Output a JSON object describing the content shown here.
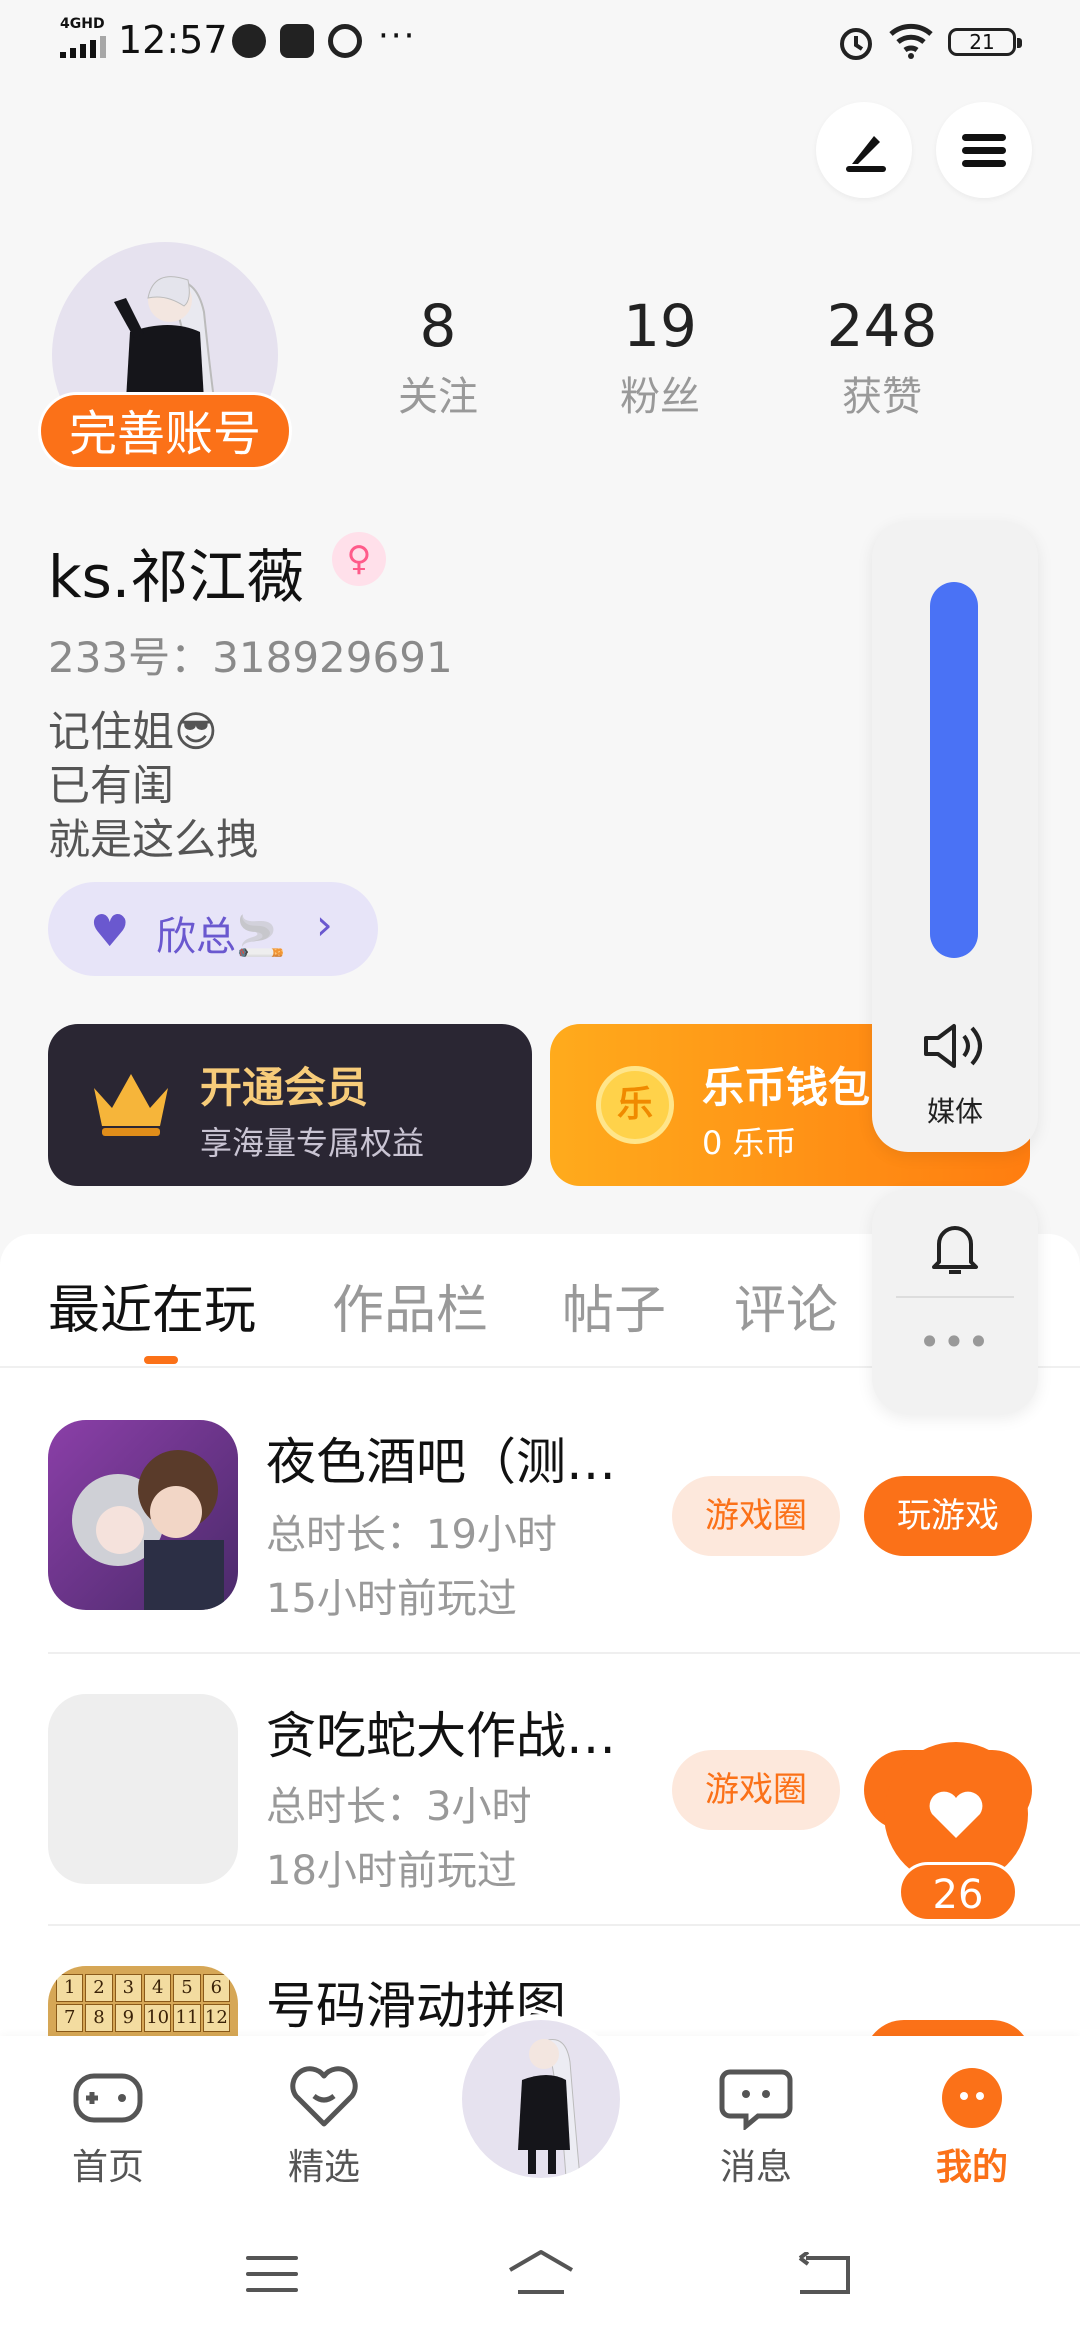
{
  "status_bar": {
    "time": "12:57",
    "network": "4GHD",
    "dots": "···",
    "battery": "21"
  },
  "profile": {
    "complete_label": "完善账号",
    "stats": [
      {
        "num": "8",
        "label": "关注"
      },
      {
        "num": "19",
        "label": "粉丝"
      },
      {
        "num": "248",
        "label": "获赞"
      }
    ],
    "username": "ks.祁江薇",
    "gender_icon": "♀",
    "uid": "233号：318929691",
    "bio": [
      "记住姐😎",
      "已有闺",
      "就是这么拽"
    ],
    "fanclub_label": "欣总🚬",
    "fanclub_arrow": "›"
  },
  "cards": {
    "vip_title": "开通会员",
    "vip_sub": "享海量专属权益",
    "coin_title": "乐币钱包",
    "coin_sub": "0 乐币",
    "coin_symbol": "乐"
  },
  "tabs": [
    {
      "label": "最近在玩",
      "active": true
    },
    {
      "label": "作品栏",
      "active": false
    },
    {
      "label": "帖子",
      "active": false
    },
    {
      "label": "评论",
      "active": false
    }
  ],
  "games": [
    {
      "title": "夜色酒吧（测…",
      "total": "总时长：19小时",
      "last": "15小时前玩过",
      "circle": "游戏圈",
      "play": "玩游戏"
    },
    {
      "title": "贪吃蛇大作战…",
      "total": "总时长：3小时",
      "last": "18小时前玩过",
      "circle": "游戏圈",
      "play": "玩游戏"
    },
    {
      "title": "号码滑动拼图",
      "puzzle": [
        "1",
        "2",
        "3",
        "4",
        "5",
        "6",
        "7",
        "8",
        "9",
        "10",
        "11",
        "12"
      ]
    }
  ],
  "volume": {
    "label": "媒体",
    "level": 1.0,
    "more": "•••"
  },
  "like": {
    "count": "26"
  },
  "bottom_nav": [
    {
      "label": "首页",
      "icon": "gamepad-icon"
    },
    {
      "label": "精选",
      "icon": "heart-chat-icon"
    },
    {
      "label": "消息",
      "icon": "message-icon"
    },
    {
      "label": "我的",
      "icon": "face-icon",
      "active": true
    }
  ],
  "colors": {
    "accent": "#fb7118",
    "volume": "#4a72f5",
    "fanclub": "#6a58cf"
  }
}
